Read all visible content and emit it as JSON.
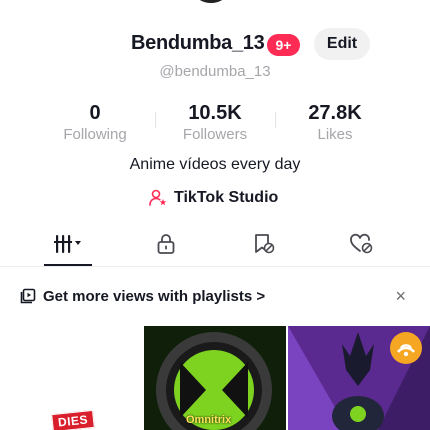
{
  "profile": {
    "username": "Bendumba_13",
    "notification_count": "9+",
    "edit_label": "Edit",
    "handle": "@bendumba_13",
    "bio": "Anime vídeos every day",
    "studio_label": "TikTok Studio"
  },
  "stats": {
    "following": {
      "value": "0",
      "label": "Following"
    },
    "followers": {
      "value": "10.5K",
      "label": "Followers"
    },
    "likes": {
      "value": "27.8K",
      "label": "Likes"
    }
  },
  "tabs": [
    {
      "name": "videos",
      "icon": "grid-icon",
      "active": true
    },
    {
      "name": "private",
      "icon": "lock-icon",
      "active": false
    },
    {
      "name": "saved",
      "icon": "bookmark-icon",
      "active": false
    },
    {
      "name": "liked",
      "icon": "heart-icon",
      "active": false
    }
  ],
  "playlist_banner": {
    "text": "Get more views with playlists",
    "chevron": ">",
    "close": "×"
  },
  "thumbnails": [
    {
      "badge": "DIES"
    },
    {
      "label": "Omnitrix"
    },
    {
      "label": ""
    }
  ],
  "colors": {
    "accent": "#fe2c55",
    "text": "#161823",
    "muted": "#a6a6ab"
  }
}
